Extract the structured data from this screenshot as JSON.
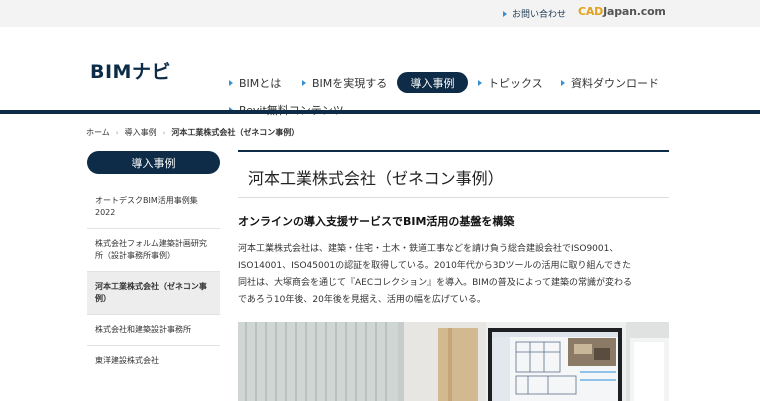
{
  "topbar": {
    "contact_label": "お問い合わせ",
    "cad_logo_cad": "CAD",
    "cad_logo_rest": "Japan.com"
  },
  "header": {
    "logo": "BIMナビ",
    "nav": [
      "BIMとは",
      "BIMを実現する",
      "導入事例",
      "トピックス",
      "資料ダウンロード",
      "Revit無料コンテンツ"
    ]
  },
  "breadcrumb": [
    "ホーム",
    "導入事例",
    "河本工業株式会社（ゼネコン事例）"
  ],
  "sidebar": {
    "heading": "導入事例",
    "items": [
      "オートデスクBIM活用事例集2022",
      "株式会社フォルム建築計画研究所（設計事務所事例）",
      "河本工業株式会社（ゼネコン事例）",
      "株式会社和建築設計事務所",
      "東洋建設株式会社"
    ],
    "active_index": 2
  },
  "main": {
    "title": "河本工業株式会社（ゼネコン事例）",
    "lead": "オンラインの導入支援サービスでBIM活用の基盤を構築",
    "body_lines": [
      "河本工業株式会社は、建築・住宅・土木・鉄道工事などを請け負う総合建設会社でISO9001、",
      "ISO14001、ISO45001の認証を取得している。2010年代から3Dツールの活用に取り組んできた",
      "同社は、大塚商会を通じて『AECコレクション』を導入。BIMの普及によって建築の常識が変わる",
      "であろう10年後、20年後を見据え、活用の幅を広げている。"
    ]
  },
  "colors": {
    "navy": "#0e2c47",
    "accent_blue": "#3a8fd0",
    "cad_orange": "#e3a21b"
  }
}
